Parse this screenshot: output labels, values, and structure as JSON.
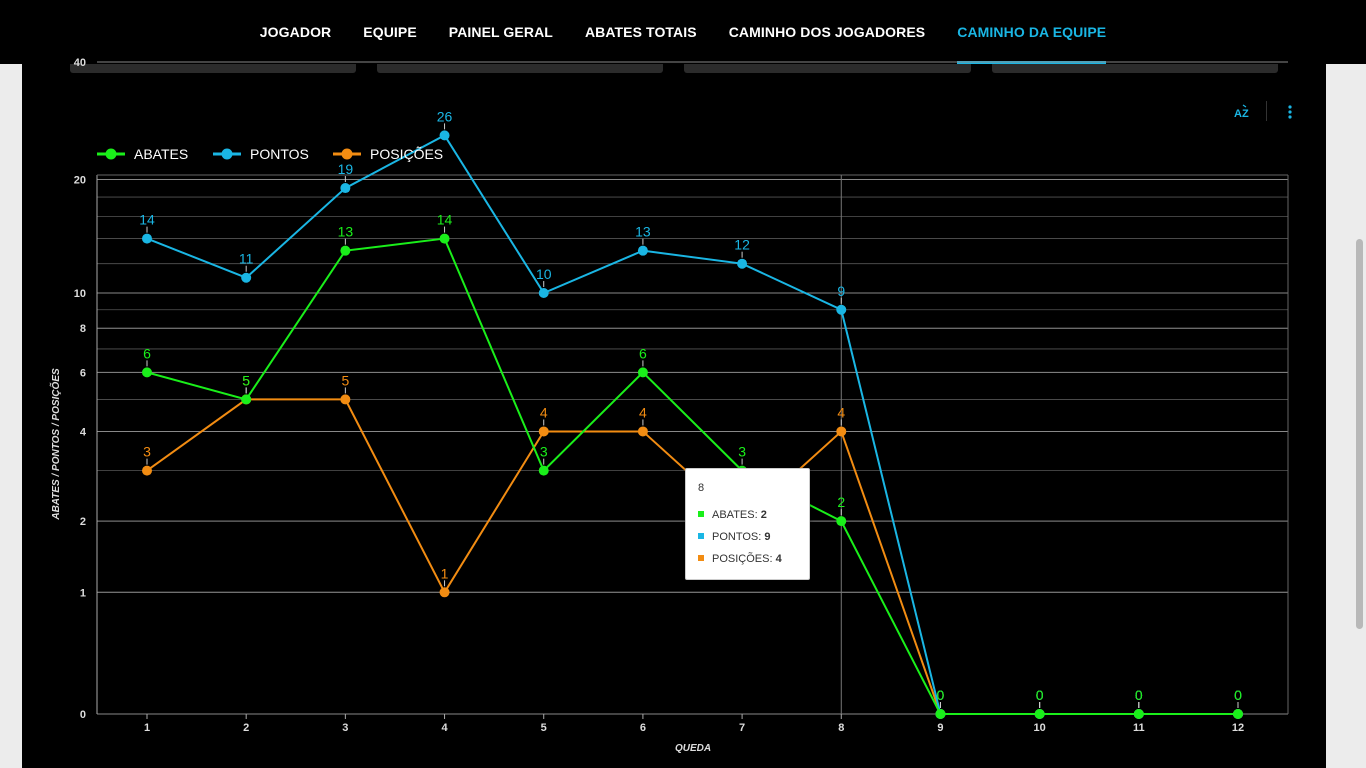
{
  "nav": {
    "items": [
      "JOGADOR",
      "EQUIPE",
      "PAINEL GERAL",
      "ABATES TOTAIS",
      "CAMINHO DOS JOGADORES",
      "CAMINHO DA EQUIPE"
    ],
    "active_index": 5
  },
  "toolbar": {
    "sort_icon": "sort-az-icon",
    "menu_icon": "more-vert-icon"
  },
  "colors": {
    "abates": "#1aef1a",
    "pontos": "#1ab6e4",
    "posicoes": "#f28c12",
    "accent": "#1ab6e4"
  },
  "tooltip": {
    "title": "8",
    "rows": [
      {
        "label": "ABATES:",
        "value": "2",
        "color": "#1aef1a"
      },
      {
        "label": "PONTOS:",
        "value": "9",
        "color": "#1ab6e4"
      },
      {
        "label": "POSIÇÕES:",
        "value": "4",
        "color": "#f28c12"
      }
    ]
  },
  "chart_data": {
    "type": "line",
    "xlabel": "QUEDA",
    "ylabel": "ABATES / PONTOS / POSIÇÕES",
    "y_scale": "log",
    "ylim": [
      0,
      40
    ],
    "y_ticks": [
      0,
      1,
      2,
      4,
      6,
      8,
      10,
      20,
      40
    ],
    "categories": [
      "1",
      "2",
      "3",
      "4",
      "5",
      "6",
      "7",
      "8",
      "9",
      "10",
      "11",
      "12"
    ],
    "legend_position": "top-left",
    "series": [
      {
        "name": "ABATES",
        "values": [
          6,
          5,
          13,
          14,
          3,
          6,
          3,
          2,
          0,
          0,
          0,
          0
        ]
      },
      {
        "name": "PONTOS",
        "values": [
          14,
          11,
          19,
          26,
          10,
          13,
          12,
          9,
          0,
          0,
          0,
          0
        ]
      },
      {
        "name": "POSIÇÕES",
        "values": [
          3,
          5,
          5,
          1,
          4,
          4,
          2,
          4,
          0,
          0,
          0,
          0
        ]
      }
    ],
    "highlighted_category": "8"
  }
}
